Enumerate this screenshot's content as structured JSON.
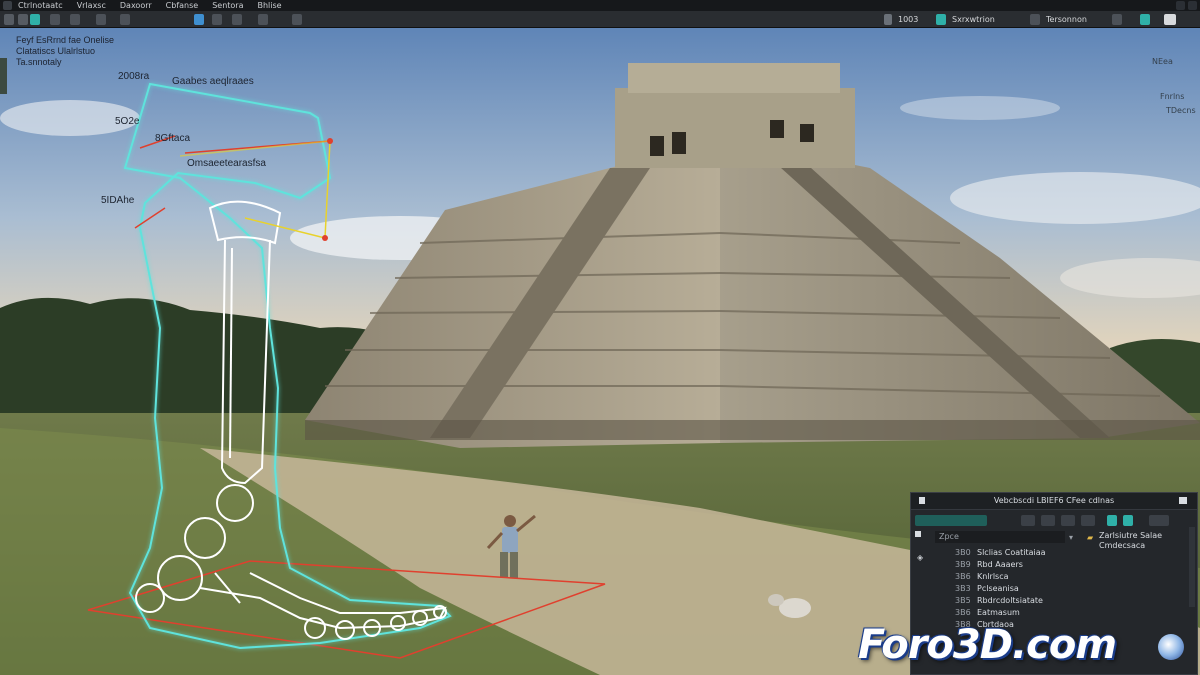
{
  "menu": {
    "items": [
      "Ctrlnotaatc",
      "Vrlaxsc",
      "Daxoorr",
      "Cbfanse",
      "Sentora",
      "Bhlise"
    ]
  },
  "toolbar": {
    "field_value": "1003",
    "mode_label": "Sxrxwtrion",
    "render_label": "Tersonnon",
    "accent": "#2fb0a8"
  },
  "viewport": {
    "hud_title": [
      "Feyf EsRrnd fae Onelise",
      "Clatatiscs Ulalrlstuo",
      "Ta.snnotaly"
    ],
    "annotations": {
      "a1": "2008ra",
      "a2": "Gaabes aeqlraaes",
      "a3": "5O2e",
      "a4": "8Gftaca",
      "a5": "Omsaeetearasfsa",
      "a6": "5IDAhe"
    },
    "side_labels": [
      "NEea",
      "Fnrlns",
      "TDecns"
    ],
    "overlay_colors": {
      "bone_glow": "#5fe3dc",
      "plane": "#e0402e",
      "measure": "#e8d22c"
    }
  },
  "panel": {
    "title": "Vebcbscdi LBIEF6 CFee cdlnas",
    "search_placeholder": "Zpce",
    "right_items": [
      "Zarlsiutre Salae",
      "Cmdecsaca"
    ],
    "rows": [
      {
        "id": "3B0",
        "name": "Slclias Coatitaiaa"
      },
      {
        "id": "3B9",
        "name": "Rbd Aaaers"
      },
      {
        "id": "3B6",
        "name": "Knlrlsca"
      },
      {
        "id": "3B3",
        "name": "Pclseanisa"
      },
      {
        "id": "3B5",
        "name": "Rbdrcdoltsiatate"
      },
      {
        "id": "3B6",
        "name": "Eatmasum"
      },
      {
        "id": "3B8",
        "name": "Cbrtdaoa"
      }
    ]
  },
  "watermark": {
    "text": "Foro3D.com"
  }
}
